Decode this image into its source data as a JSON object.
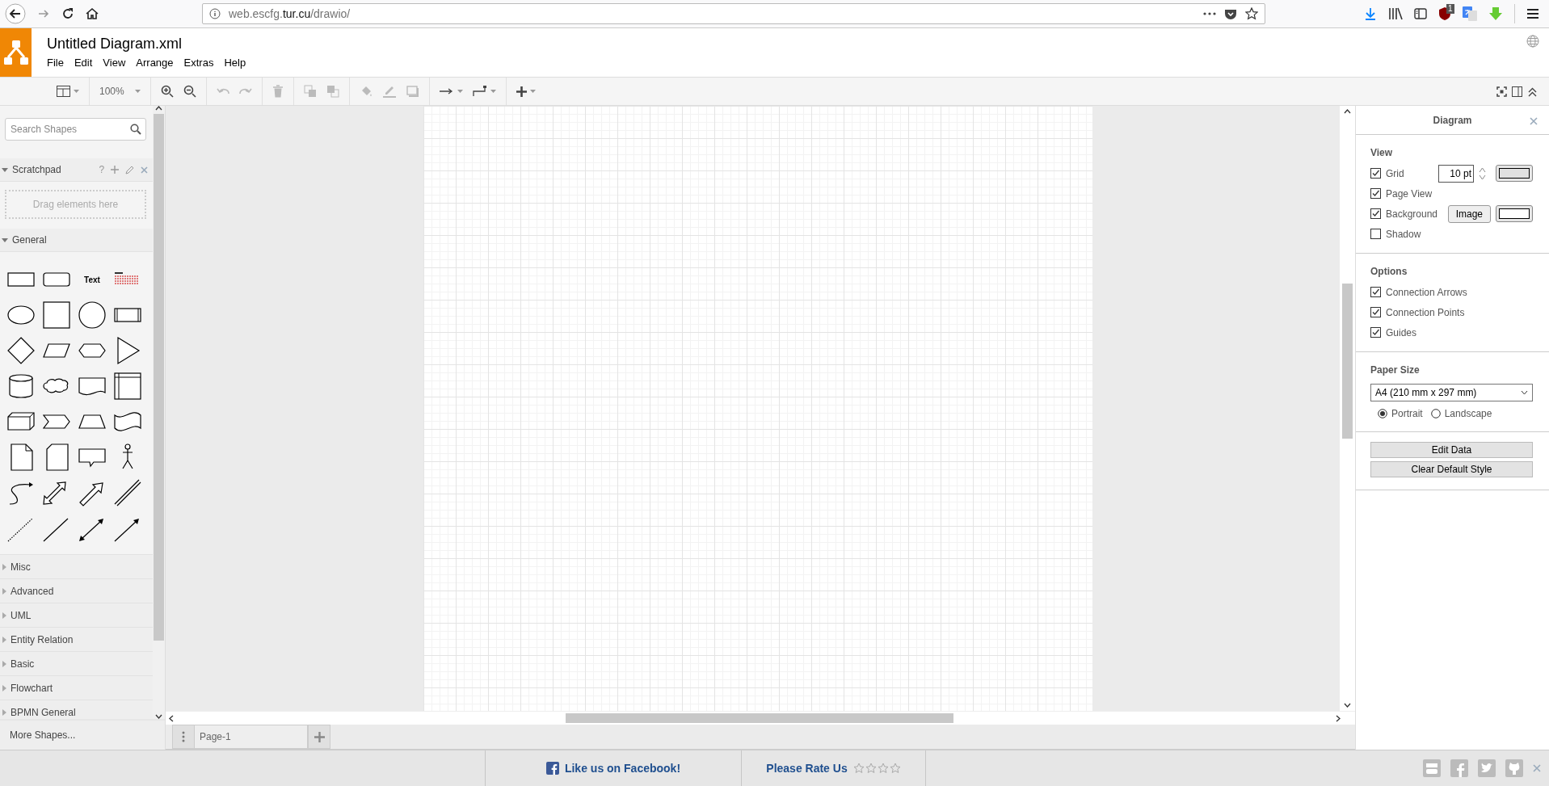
{
  "browser": {
    "url": "web.escfg.**tur.cu**/drawio/",
    "badge": "1"
  },
  "app": {
    "title": "Untitled Diagram.xml",
    "menus": [
      "File",
      "Edit",
      "View",
      "Arrange",
      "Extras",
      "Help"
    ]
  },
  "toolbar": {
    "zoom": "100%"
  },
  "sidebar": {
    "search": {
      "placeholder": "Search Shapes"
    },
    "scratchpad": {
      "title": "Scratchpad",
      "help": "?",
      "drop_hint": "Drag elements here",
      "expanded": true
    },
    "general": {
      "title": "General",
      "expanded": true,
      "text_shape": "Text"
    },
    "categories": [
      {
        "label": "Misc",
        "expanded": false
      },
      {
        "label": "Advanced",
        "expanded": false
      },
      {
        "label": "UML",
        "expanded": false
      },
      {
        "label": "Entity Relation",
        "expanded": false
      },
      {
        "label": "Basic",
        "expanded": false
      },
      {
        "label": "Flowchart",
        "expanded": false
      },
      {
        "label": "BPMN General",
        "expanded": false
      }
    ],
    "more": "More Shapes..."
  },
  "pages": [
    {
      "label": "Page-1",
      "selected": true
    }
  ],
  "format_panel": {
    "title": "Diagram",
    "view": {
      "title": "View",
      "items": [
        {
          "kind": "grid",
          "label": "Grid",
          "checked": true,
          "value": "10 pt"
        },
        {
          "kind": "plain",
          "label": "Page View",
          "checked": true
        },
        {
          "kind": "background",
          "label": "Background",
          "checked": true,
          "button": "Image"
        },
        {
          "kind": "plain",
          "label": "Shadow",
          "checked": false
        }
      ]
    },
    "options": {
      "title": "Options",
      "items": [
        {
          "label": "Connection Arrows",
          "checked": true
        },
        {
          "label": "Connection Points",
          "checked": true
        },
        {
          "label": "Guides",
          "checked": true
        }
      ]
    },
    "paper": {
      "title": "Paper Size",
      "size": "A4 (210 mm x 297 mm)",
      "orientations": [
        {
          "label": "Portrait",
          "selected": true
        },
        {
          "label": "Landscape",
          "selected": false
        }
      ]
    },
    "buttons": [
      "Edit Data",
      "Clear Default Style"
    ]
  },
  "footer": {
    "facebook": "Like us on Facebook!",
    "rate": "Please Rate Us",
    "stars": 0
  }
}
